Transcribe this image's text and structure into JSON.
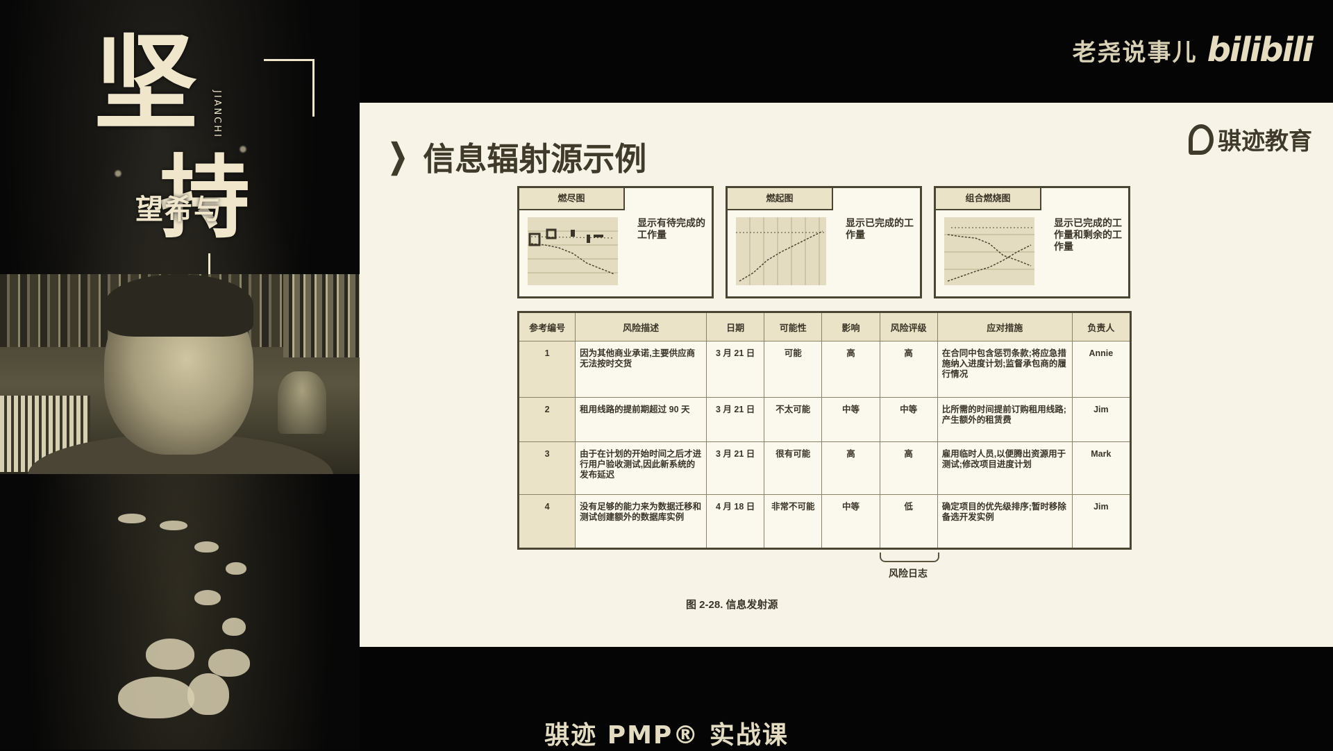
{
  "poster": {
    "char1": "坚",
    "char2": "持",
    "sub": "与希望",
    "pinyin": "JIANCHI"
  },
  "brand": {
    "name": "老尧说事儿",
    "logo": "bilibili"
  },
  "slide": {
    "title": "信息辐射源示例",
    "company": "骐迹教育",
    "panels": [
      {
        "tab": "燃尽图",
        "desc": "显示有待完成的工作量"
      },
      {
        "tab": "燃起图",
        "desc": "显示已完成的工作量"
      },
      {
        "tab": "组合燃烧图",
        "desc": "显示已完成的工作量和剩余的工作量"
      }
    ],
    "table": {
      "headers": [
        "参考编号",
        "风险描述",
        "日期",
        "可能性",
        "影响",
        "风险评级",
        "应对措施",
        "负责人"
      ],
      "rows": [
        {
          "ref": "1",
          "desc": "因为其他商业承诺,主要供应商无法按时交货",
          "date": "3 月 21 日",
          "likelihood": "可能",
          "impact": "高",
          "rating": "高",
          "response": "在合同中包含惩罚条款;将应急措施纳入进度计划;监督承包商的履行情况",
          "owner": "Annie"
        },
        {
          "ref": "2",
          "desc": "租用线路的提前期超过 90 天",
          "date": "3 月 21 日",
          "likelihood": "不太可能",
          "impact": "中等",
          "rating": "中等",
          "response": "比所需的时间提前订购租用线路;产生额外的租赁费",
          "owner": "Jim"
        },
        {
          "ref": "3",
          "desc": "由于在计划的开始时间之后才进行用户验收测试,因此新系统的发布延迟",
          "date": "3 月 21 日",
          "likelihood": "很有可能",
          "impact": "高",
          "rating": "高",
          "response": "雇用临时人员,以便腾出资源用于测试;修改项目进度计划",
          "owner": "Mark"
        },
        {
          "ref": "4",
          "desc": "没有足够的能力来为数据迁移和测试创建额外的数据库实例",
          "date": "4 月 18 日",
          "likelihood": "非常不可能",
          "impact": "中等",
          "rating": "低",
          "response": "确定项目的优先级排序;暂时移除备选开发实例",
          "owner": "Jim"
        }
      ]
    },
    "brace_label": "风险日志",
    "caption": "图 2-28. 信息发射源"
  },
  "footer": "骐迹 PMP® 实战课"
}
